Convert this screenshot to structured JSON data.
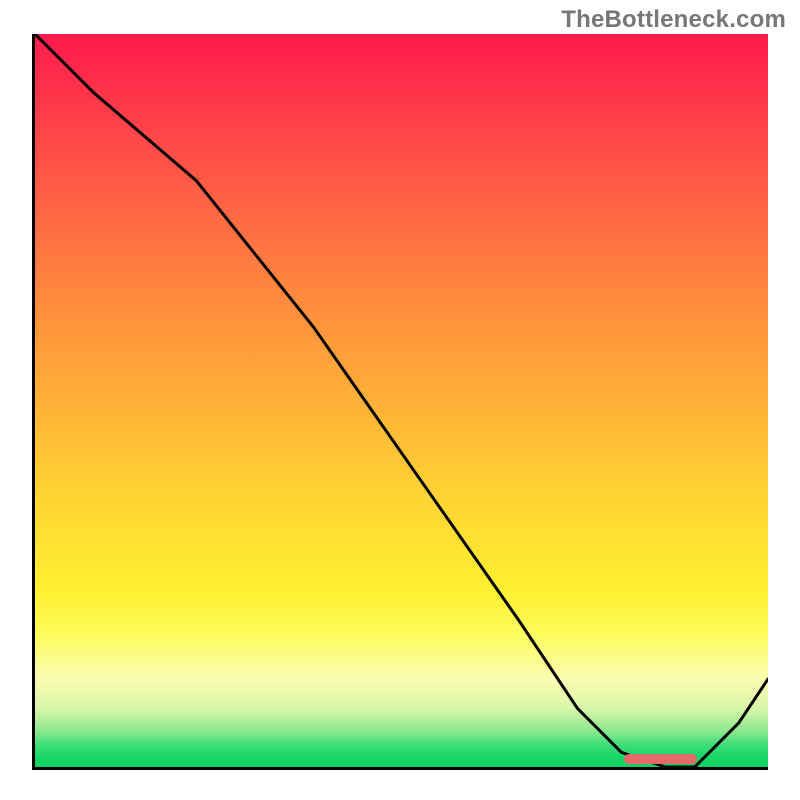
{
  "attribution": "TheBottleneck.com",
  "chart_data": {
    "type": "line",
    "title": "",
    "xlabel": "",
    "ylabel": "",
    "xlim": [
      0,
      100
    ],
    "ylim": [
      0,
      100
    ],
    "series": [
      {
        "name": "curve",
        "x": [
          0,
          8,
          22,
          38,
          52,
          66,
          74,
          80,
          86,
          90,
          96,
          100
        ],
        "values": [
          100,
          92,
          80,
          60,
          40,
          20,
          8,
          2,
          0,
          0,
          6,
          12
        ]
      }
    ],
    "marker": {
      "x_start": 80,
      "x_end": 90,
      "y": 0
    }
  }
}
